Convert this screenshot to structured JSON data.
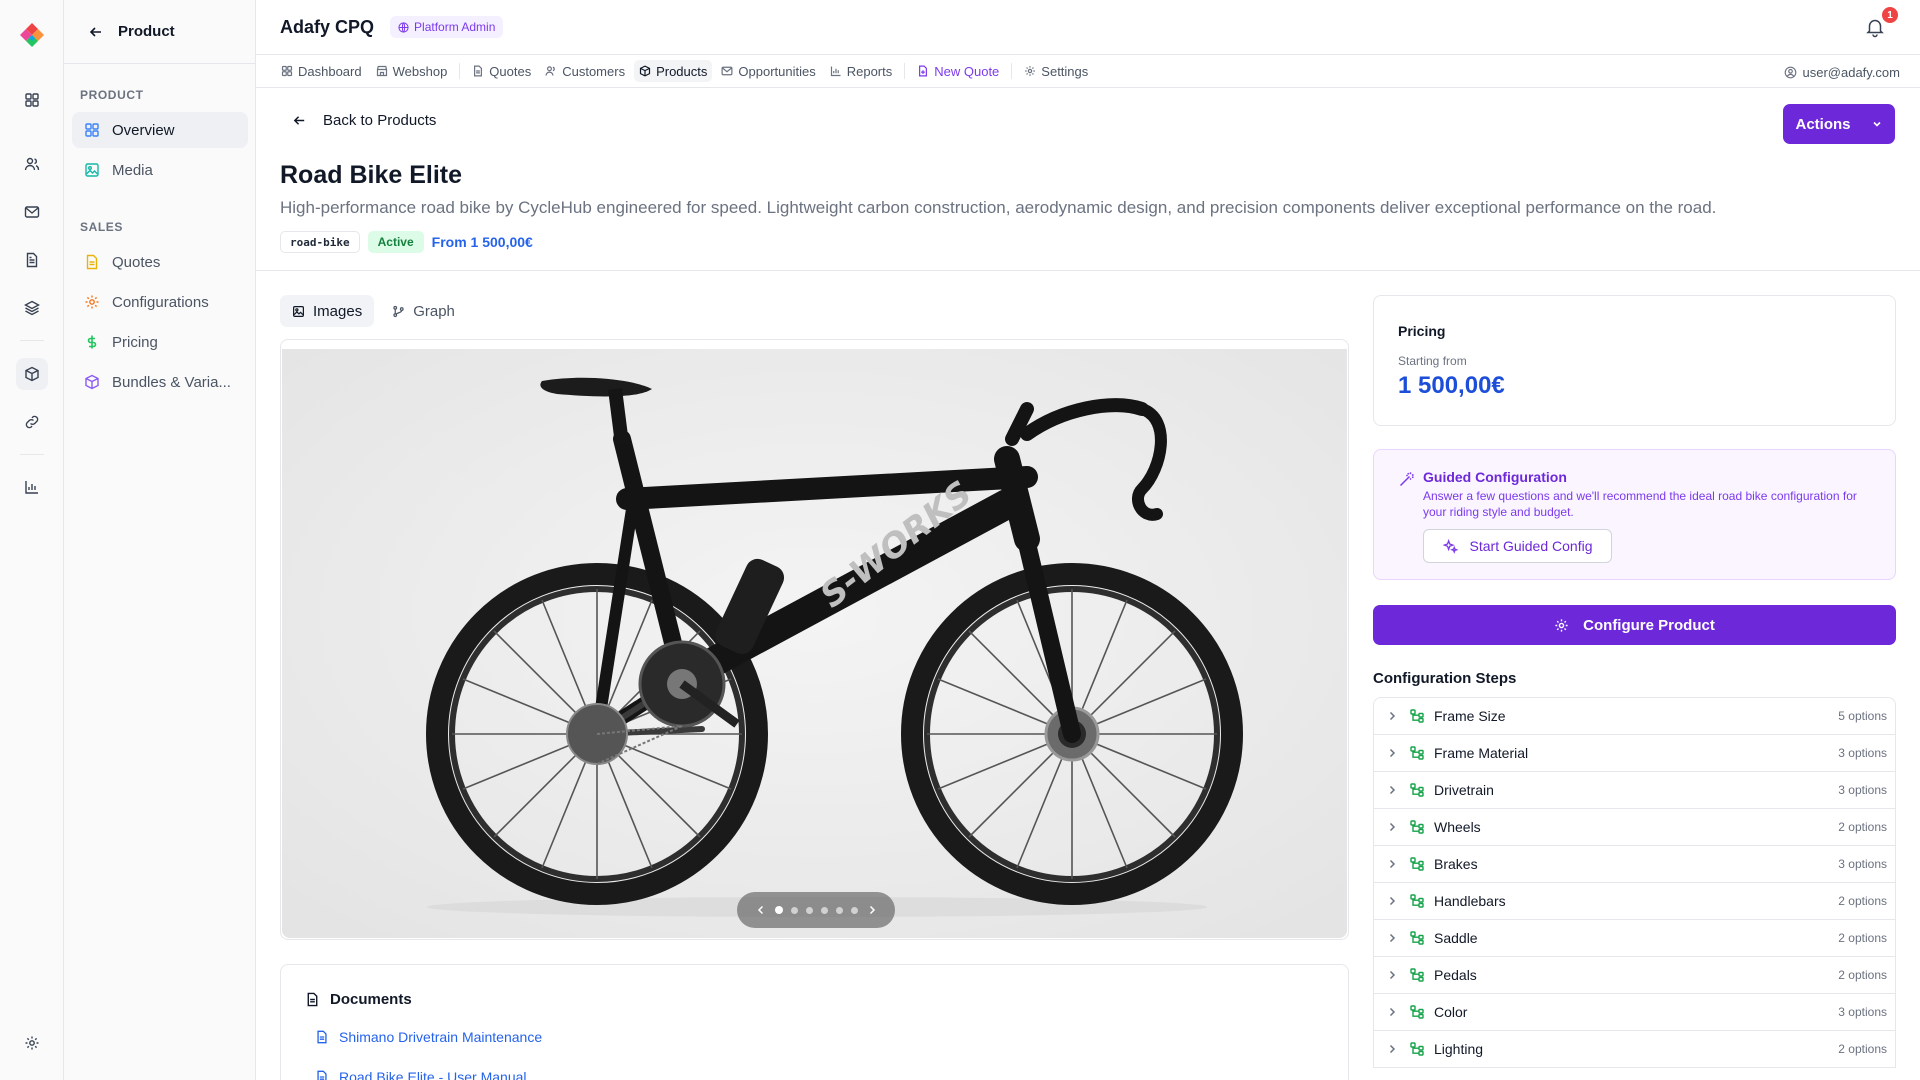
{
  "app": {
    "title": "Adafy CPQ",
    "admin_badge": "Platform Admin",
    "notification_count": "1"
  },
  "nav": {
    "items": [
      {
        "label": "Dashboard",
        "icon": "grid-icon"
      },
      {
        "label": "Webshop",
        "icon": "store-icon"
      },
      {
        "label": "Quotes",
        "icon": "document-icon"
      },
      {
        "label": "Customers",
        "icon": "users-icon"
      },
      {
        "label": "Products",
        "icon": "package-icon"
      },
      {
        "label": "Opportunities",
        "icon": "mail-icon"
      },
      {
        "label": "Reports",
        "icon": "chart-icon"
      },
      {
        "label": "New Quote",
        "icon": "file-plus-icon"
      },
      {
        "label": "Settings",
        "icon": "gear-icon"
      }
    ],
    "user": "user@adafy.com"
  },
  "sidebar": {
    "header": "Product",
    "section_product": "PRODUCT",
    "section_sales": "SALES",
    "items": [
      {
        "label": "Overview"
      },
      {
        "label": "Media"
      },
      {
        "label": "Quotes"
      },
      {
        "label": "Configurations"
      },
      {
        "label": "Pricing"
      },
      {
        "label": "Bundles & Varia..."
      }
    ]
  },
  "page": {
    "back_label": "Back to Products",
    "actions_label": "Actions",
    "title": "Road Bike Elite",
    "description": "High-performance road bike by CycleHub engineered for speed. Lightweight carbon construction, aerodynamic design, and precision components deliver exceptional performance on the road.",
    "tag_code": "road-bike",
    "status": "Active",
    "from_price": "From 1 500,00€"
  },
  "tabs": [
    {
      "label": "Images"
    },
    {
      "label": "Graph"
    }
  ],
  "carousel": {
    "count": 6,
    "active_index": 0
  },
  "documents": {
    "title": "Documents",
    "items": [
      {
        "label": "Shimano Drivetrain Maintenance"
      },
      {
        "label": "Road Bike Elite - User Manual"
      }
    ]
  },
  "pricing": {
    "label": "Pricing",
    "sub": "Starting from",
    "price": "1 500,00€"
  },
  "guided": {
    "title": "Guided Configuration",
    "description": "Answer a few questions and we'll recommend the ideal road bike configuration for your riding style and budget.",
    "button": "Start Guided Config"
  },
  "configure_button": "Configure Product",
  "steps": {
    "title": "Configuration Steps",
    "items": [
      {
        "name": "Frame Size",
        "count": "5 options"
      },
      {
        "name": "Frame Material",
        "count": "3 options"
      },
      {
        "name": "Drivetrain",
        "count": "3 options"
      },
      {
        "name": "Wheels",
        "count": "2 options"
      },
      {
        "name": "Brakes",
        "count": "3 options"
      },
      {
        "name": "Handlebars",
        "count": "2 options"
      },
      {
        "name": "Saddle",
        "count": "2 options"
      },
      {
        "name": "Pedals",
        "count": "2 options"
      },
      {
        "name": "Color",
        "count": "3 options"
      },
      {
        "name": "Lighting",
        "count": "2 options"
      }
    ]
  },
  "colors": {
    "accent": "#6d28d9",
    "link": "#2563eb",
    "active_green": "#15803d"
  }
}
